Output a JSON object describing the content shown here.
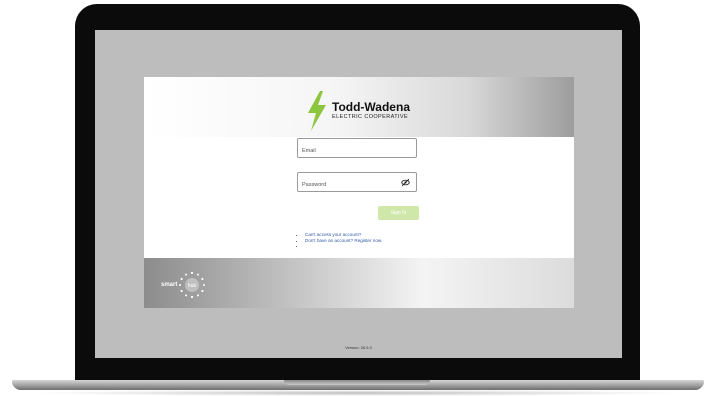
{
  "header": {
    "brand_name": "Todd-Wadena",
    "brand_sub": "ELECTRIC COOPERATIVE"
  },
  "login": {
    "email_placeholder": "Email",
    "password_placeholder": "Password",
    "signin_label": "Sign In",
    "links": [
      "Can't access your account?",
      "Don't have an account? Register now."
    ]
  },
  "footer": {
    "smart_word": "smart",
    "hub_word": "hub"
  },
  "version": "Version: 26.5.0",
  "colors": {
    "brand_green": "#8cc63f",
    "signin_bg": "#cfe8a9",
    "link_blue": "#2f58a8"
  }
}
